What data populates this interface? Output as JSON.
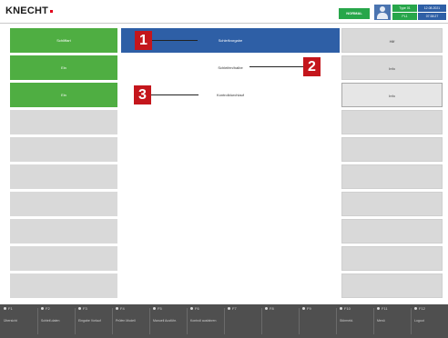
{
  "header": {
    "logo": "KNECHT",
    "mode_badge": "NORMAL",
    "info_green_top": "Type 01",
    "info_blue_top": "12.08.2021",
    "info_green_bot": "PL1",
    "info_blue_bot": "07:38:27",
    "user_icon": "user-icon"
  },
  "left_buttons": [
    {
      "label": "Schliffart",
      "active": true
    },
    {
      "label": "Ein",
      "active": true
    },
    {
      "label": "Ein",
      "active": true
    },
    {
      "label": "",
      "active": false
    },
    {
      "label": "",
      "active": false
    },
    {
      "label": "",
      "active": false
    },
    {
      "label": "",
      "active": false
    },
    {
      "label": "",
      "active": false
    },
    {
      "label": "",
      "active": false
    },
    {
      "label": "",
      "active": false
    }
  ],
  "middle_rows": [
    {
      "label": "Schleifvorgabe",
      "selected": true
    },
    {
      "label": "Schleifen/halbe",
      "selected": false
    },
    {
      "label": "Kontrolldurchlauf",
      "selected": false
    },
    {
      "label": "",
      "selected": false
    },
    {
      "label": "",
      "selected": false
    },
    {
      "label": "",
      "selected": false
    },
    {
      "label": "",
      "selected": false
    },
    {
      "label": "",
      "selected": false
    },
    {
      "label": "",
      "selected": false
    },
    {
      "label": "",
      "selected": false
    }
  ],
  "right_buttons": [
    {
      "label": "Hilf",
      "outlined": false
    },
    {
      "label": "Info",
      "outlined": false
    },
    {
      "label": "Info",
      "outlined": true
    },
    {
      "label": "",
      "outlined": false
    },
    {
      "label": "",
      "outlined": false
    },
    {
      "label": "",
      "outlined": false
    },
    {
      "label": "",
      "outlined": false
    },
    {
      "label": "",
      "outlined": false
    },
    {
      "label": "",
      "outlined": false
    },
    {
      "label": "",
      "outlined": false
    }
  ],
  "callouts": [
    "1",
    "2",
    "3"
  ],
  "footer": {
    "keys": [
      {
        "num": "F1",
        "label": "Übersicht"
      },
      {
        "num": "F2",
        "label": "Schleif-daten"
      },
      {
        "num": "F3",
        "label": "Eingabe Vorlauf"
      },
      {
        "num": "F4",
        "label": "Prüfen Modell"
      },
      {
        "num": "F5",
        "label": "Manuell Ausführ."
      },
      {
        "num": "F6",
        "label": "Kontroll ausfahren"
      },
      {
        "num": "F7",
        "label": ""
      },
      {
        "num": "F8",
        "label": ""
      },
      {
        "num": "F9",
        "label": ""
      },
      {
        "num": "F10",
        "label": "Störmeld."
      },
      {
        "num": "F11",
        "label": "Menü"
      },
      {
        "num": "F12",
        "label": "Logout"
      }
    ]
  },
  "colors": {
    "accent_blue": "#2e5fa6",
    "active_green": "#4fae42",
    "callout_red": "#c4161c",
    "footer_bg": "#4f4f4f"
  }
}
